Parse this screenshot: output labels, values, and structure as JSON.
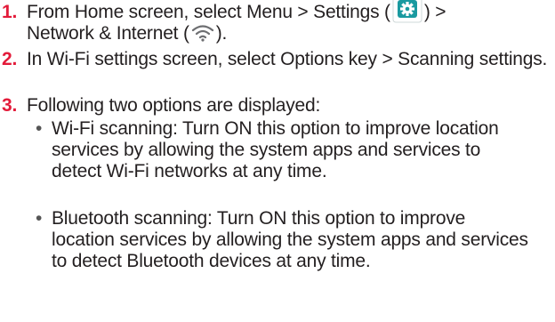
{
  "steps": [
    {
      "number": "1.",
      "text_a": "From Home screen, select Menu > Settings (",
      "text_b": ") >",
      "text_c": "Network & Internet (",
      "text_d": ").",
      "icons": [
        "settings-gear-icon",
        "wifi-icon"
      ]
    },
    {
      "number": "2.",
      "text": "In Wi-Fi settings screen, select Options key > Scanning settings."
    },
    {
      "number": "3.",
      "text": "Following two options are displayed:",
      "bullets": [
        {
          "marker": "•",
          "text": "Wi-Fi scanning: Turn ON this option to improve location services by allowing the system apps and services to detect Wi-Fi networks at any time."
        },
        {
          "marker": "•",
          "text": "Bluetooth scanning: Turn ON this option to improve location services by allowing the system apps and services to detect Bluetooth devices at any time."
        }
      ]
    }
  ],
  "colors": {
    "number": "#e31b3a",
    "text": "#231f20",
    "settings_icon_bg": "#1a9aa0"
  }
}
